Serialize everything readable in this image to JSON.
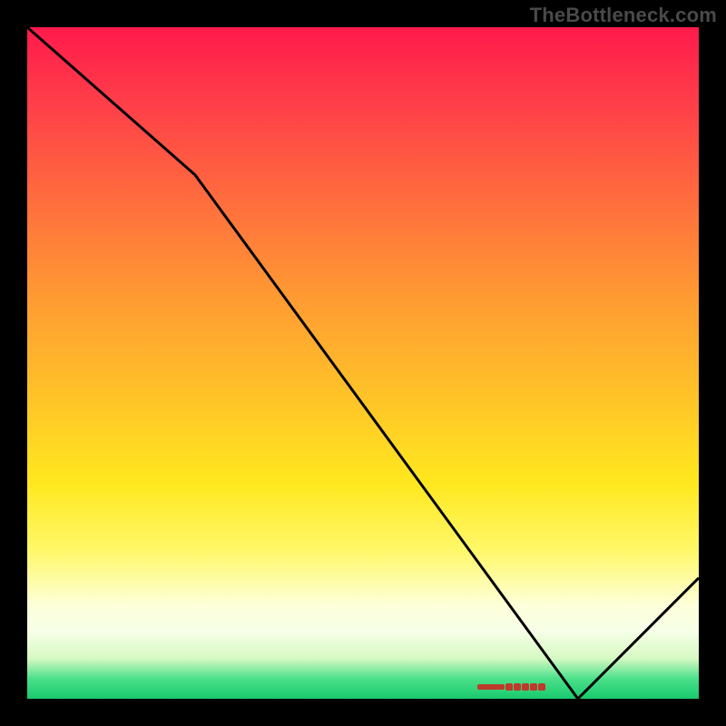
{
  "attribution": "TheBottleneck.com",
  "colors": {
    "frame": "#000000",
    "gradient_top": "#ff1a4b",
    "gradient_bottom": "#18c96e",
    "curve": "#000000",
    "optimal_marker": "#c0392b",
    "attribution_text": "#4a4a4a"
  },
  "chart_data": {
    "type": "line",
    "title": "",
    "xlabel": "",
    "ylabel": "",
    "x": [
      0,
      25,
      82,
      100
    ],
    "values": [
      100,
      78,
      0,
      18
    ],
    "xlim": [
      0,
      100
    ],
    "ylim": [
      0,
      100
    ],
    "grid": false,
    "legend": false,
    "optimal_range_x": [
      67,
      80
    ],
    "note": "Values estimated from pixel positions; 0 = bottom/green, 100 = top/red. Curve starts at top-left, slight slope change near x≈25, descends to minimum ≈0 near x≈82, then rises to ≈18 at right edge. Small red marker band along the bottom indicates the optimal zone."
  }
}
